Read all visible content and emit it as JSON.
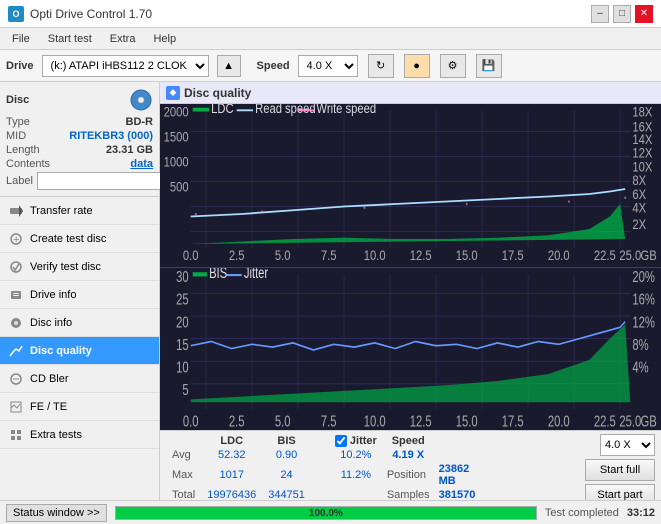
{
  "titlebar": {
    "title": "Opti Drive Control 1.70",
    "minimize": "–",
    "maximize": "□",
    "close": "✕"
  },
  "menubar": {
    "items": [
      "File",
      "Start test",
      "Extra",
      "Help"
    ]
  },
  "drivebar": {
    "drive_label": "Drive",
    "drive_value": "(k:) ATAPI iHBS112  2 CLOK",
    "speed_label": "Speed",
    "speed_value": "4.0 X"
  },
  "disc": {
    "title": "Disc",
    "type_label": "Type",
    "type_value": "BD-R",
    "mid_label": "MID",
    "mid_value": "RITEKBR3 (000)",
    "length_label": "Length",
    "length_value": "23.31 GB",
    "contents_label": "Contents",
    "contents_value": "data",
    "label_label": "Label",
    "label_value": ""
  },
  "nav_items": [
    {
      "id": "transfer-rate",
      "label": "Transfer rate",
      "active": false
    },
    {
      "id": "create-test-disc",
      "label": "Create test disc",
      "active": false
    },
    {
      "id": "verify-test-disc",
      "label": "Verify test disc",
      "active": false
    },
    {
      "id": "drive-info",
      "label": "Drive info",
      "active": false
    },
    {
      "id": "disc-info",
      "label": "Disc info",
      "active": false
    },
    {
      "id": "disc-quality",
      "label": "Disc quality",
      "active": true
    },
    {
      "id": "cd-bler",
      "label": "CD Bler",
      "active": false
    },
    {
      "id": "fe-te",
      "label": "FE / TE",
      "active": false
    },
    {
      "id": "extra-tests",
      "label": "Extra tests",
      "active": false
    }
  ],
  "quality_panel": {
    "title": "Disc quality",
    "legend_top": [
      "LDC",
      "Read speed",
      "Write speed"
    ],
    "legend_bottom": [
      "BIS",
      "Jitter"
    ],
    "x_labels": [
      "0.0",
      "2.5",
      "5.0",
      "7.5",
      "10.0",
      "12.5",
      "15.0",
      "17.5",
      "20.0",
      "22.5",
      "25.0"
    ],
    "y_labels_top": [
      "2000",
      "1500",
      "1000",
      "500"
    ],
    "y_labels_right_top": [
      "18X",
      "16X",
      "14X",
      "12X",
      "10X",
      "8X",
      "6X",
      "4X",
      "2X"
    ],
    "y_labels_bottom": [
      "30",
      "25",
      "20",
      "15",
      "10",
      "5"
    ],
    "y_labels_right_bottom": [
      "20%",
      "16%",
      "12%",
      "8%",
      "4%"
    ]
  },
  "stats": {
    "headers": [
      "",
      "LDC",
      "BIS",
      "",
      "Jitter",
      "Speed",
      ""
    ],
    "avg_label": "Avg",
    "avg_ldc": "52.32",
    "avg_bis": "0.90",
    "avg_jitter": "10.2%",
    "speed_label": "Speed",
    "speed_value": "4.19 X",
    "max_label": "Max",
    "max_ldc": "1017",
    "max_bis": "24",
    "max_jitter": "11.2%",
    "position_label": "Position",
    "position_value": "23862 MB",
    "total_label": "Total",
    "total_ldc": "19976436",
    "total_bis": "344751",
    "samples_label": "Samples",
    "samples_value": "381570",
    "speed_dropdown": "4.0 X",
    "btn_start_full": "Start full",
    "btn_start_part": "Start part"
  },
  "statusbar": {
    "status_window_btn": "Status window >>",
    "progress_value": 100,
    "progress_text": "100.0%",
    "status_text": "Test completed",
    "time": "33:12"
  }
}
